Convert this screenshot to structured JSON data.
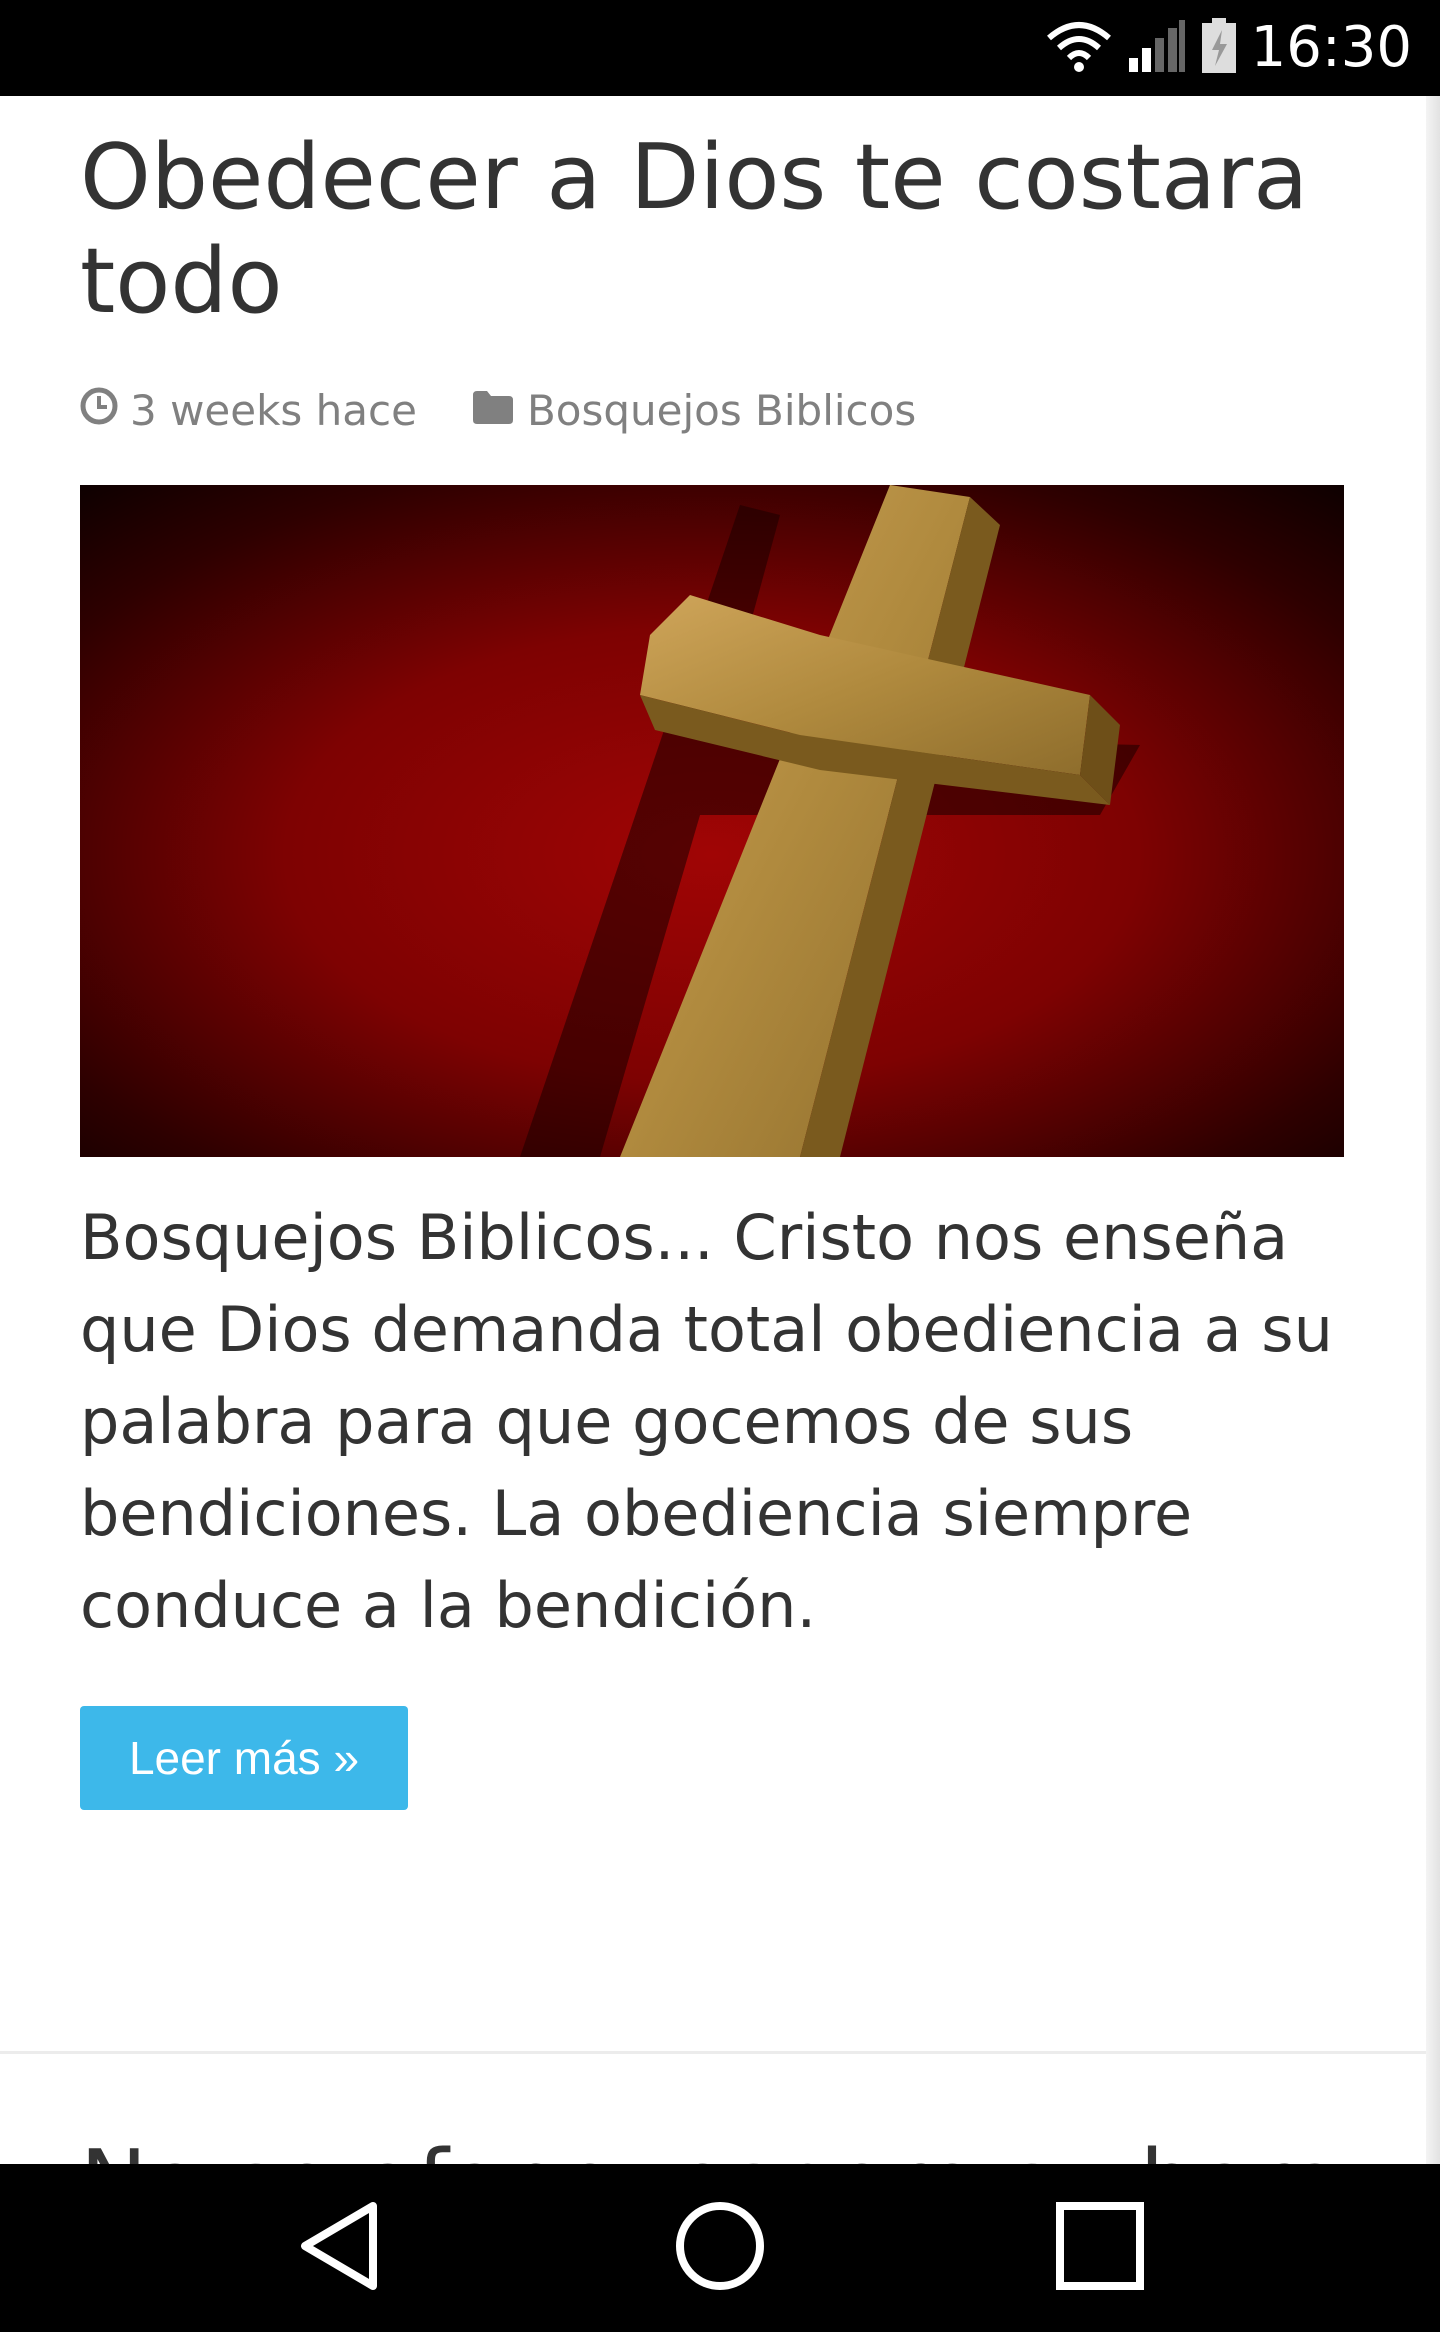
{
  "status_bar": {
    "time": "16:30",
    "icons": [
      "wifi-icon",
      "cell-signal-icon",
      "battery-charging-icon"
    ]
  },
  "post": {
    "title": "Obedecer a Dios te costara todo",
    "meta": {
      "date": "3 weeks hace",
      "category": "Bosquejos Biblicos",
      "date_icon": "clock-icon",
      "category_icon": "folder-icon"
    },
    "image": {
      "subject": "golden cross on red background",
      "colors": {
        "background": "#8b0000",
        "cross": "#b08a3e"
      }
    },
    "excerpt": "Bosquejos Biblicos... Cristo nos enseña que Dios demanda total obediencia a su palabra para que gocemos de sus bendiciones. La obediencia siempre conduce a la bendición.",
    "read_more_label": "Leer más »"
  },
  "next_post": {
    "title": "No se afane, espere su hora"
  },
  "nav_bar": {
    "buttons": [
      "back-icon",
      "home-icon",
      "recents-icon"
    ]
  },
  "colors": {
    "accent": "#3db8ea",
    "text": "#333333",
    "meta_text": "#808080"
  }
}
